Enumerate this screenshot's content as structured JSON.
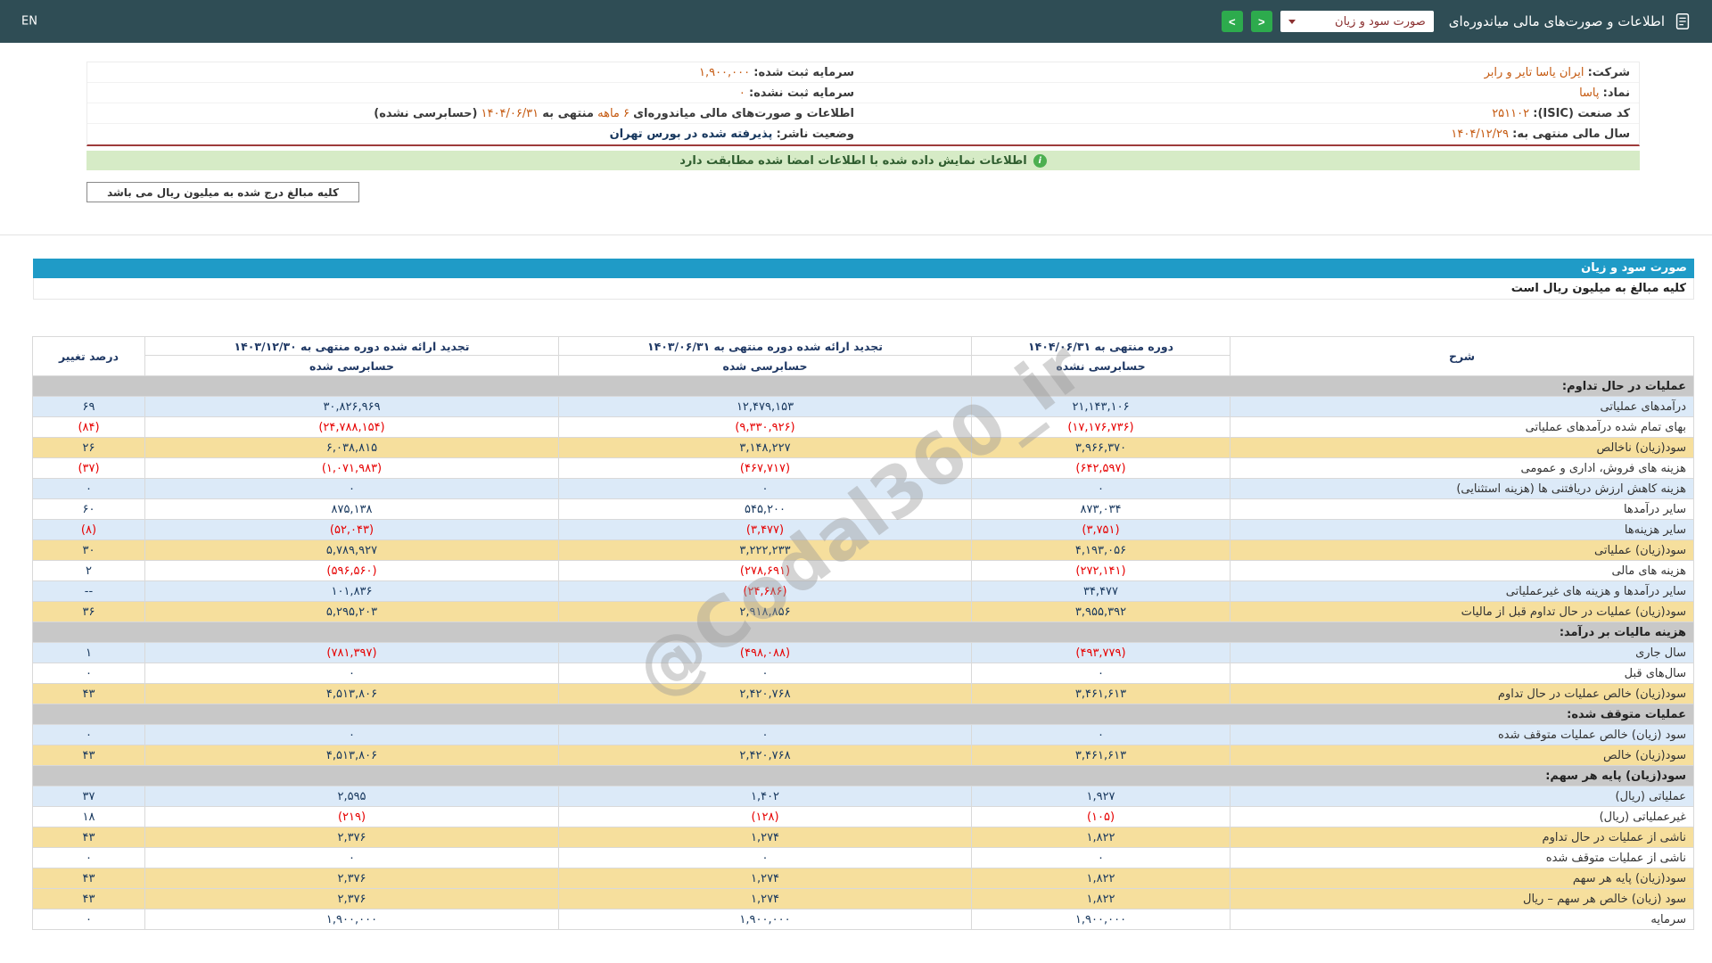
{
  "colors": {
    "topbar": "#2F4D55",
    "accent_blue": "#1F9BC7",
    "row_blue": "#DCEAF8",
    "row_yellow": "#F6DF9D",
    "row_gray": "#C8C8C8",
    "positive_navy": "#17375D",
    "negative_red": "#E60000",
    "value_orange": "#C55A11",
    "banner_green": "#D6EBC6"
  },
  "header": {
    "en_label": "EN",
    "app_title": "اطلاعات و صورت‌های مالی میاندوره‌ای",
    "statement_dropdown_value": "صورت سود و زیان",
    "nav_forward_icon": ">",
    "nav_back_icon": "<"
  },
  "company_info": {
    "company_label": "شرکت:",
    "company_value": "ایران یاسا تایر و رابر",
    "symbol_label": "نماد:",
    "symbol_value": "پاسا",
    "isic_label": "کد صنعت (ISIC):",
    "isic_value": "۲۵۱۱۰۲",
    "fiscal_year_label": "سال مالی منتهی به:",
    "fiscal_year_value": "۱۴۰۴/۱۲/۲۹",
    "registered_capital_label": "سرمایه ثبت شده:",
    "registered_capital_value": "۱,۹۰۰,۰۰۰",
    "unregistered_capital_label": "سرمایه ثبت نشده:",
    "unregistered_capital_value": "۰",
    "period_label": "اطلاعات و صورت‌های مالی میاندوره‌ای",
    "period_duration": "۶ ماهه",
    "period_mid": "منتهی به",
    "period_date": "۱۴۰۴/۰۶/۳۱",
    "period_suffix": "(حسابرسی نشده)",
    "publisher_status_label": "وضعیت ناشر:",
    "publisher_status_value": "پذیرفته شده در بورس تهران"
  },
  "banner": {
    "text": "اطلاعات نمایش داده شده با اطلاعات امضا شده مطابقت دارد",
    "icon": "i"
  },
  "note": "کلیه مبالغ درج شده به میلیون ریال می باشد",
  "statement": {
    "title": "صورت سود و زیان",
    "subtitle": "کلیه مبالغ به میلیون ریال است",
    "watermark": "@Codal360_ir",
    "columns": {
      "description": "شرح",
      "current_period": "دوره منتهی به ۱۴۰۴/۰۶/۳۱",
      "current_sub": "حسابرسی نشده",
      "prior_period": "تجدید ارائه شده دوره منتهی به ۱۴۰۳/۰۶/۳۱",
      "prior_sub": "حسابرسی شده",
      "annual_period": "تجدید ارائه شده دوره منتهی به ۱۴۰۳/۱۲/۳۰",
      "annual_sub": "حسابرسی شده",
      "change": "درصد تغییر"
    },
    "rows": [
      {
        "type": "section",
        "label": "عملیات در حال تداوم:"
      },
      {
        "type": "data",
        "shade": "blue",
        "label": "درآمدهای عملیاتی",
        "current": "۲۱,۱۴۳,۱۰۶",
        "prior": "۱۲,۴۷۹,۱۵۳",
        "annual": "۳۰,۸۲۶,۹۶۹",
        "change": "۶۹"
      },
      {
        "type": "data",
        "shade": "white",
        "label": "بهای تمام شده درآمدهای عملیاتی",
        "current": "(۱۷,۱۷۶,۷۳۶)",
        "prior": "(۹,۳۳۰,۹۲۶)",
        "annual": "(۲۴,۷۸۸,۱۵۴)",
        "change": "(۸۴)"
      },
      {
        "type": "data",
        "shade": "yellow",
        "label": "سود(زیان) ناخالص",
        "current": "۳,۹۶۶,۳۷۰",
        "prior": "۳,۱۴۸,۲۲۷",
        "annual": "۶,۰۳۸,۸۱۵",
        "change": "۲۶"
      },
      {
        "type": "data",
        "shade": "white",
        "label": "هزینه های فروش، اداری و عمومی",
        "current": "(۶۴۲,۵۹۷)",
        "prior": "(۴۶۷,۷۱۷)",
        "annual": "(۱,۰۷۱,۹۸۳)",
        "change": "(۳۷)"
      },
      {
        "type": "data",
        "shade": "blue",
        "label": "هزینه کاهش ارزش دریافتنی ها (هزینه استثنایی)",
        "current": "۰",
        "prior": "۰",
        "annual": "۰",
        "change": "۰"
      },
      {
        "type": "data",
        "shade": "white",
        "label": "سایر درآمدها",
        "current": "۸۷۳,۰۳۴",
        "prior": "۵۴۵,۲۰۰",
        "annual": "۸۷۵,۱۳۸",
        "change": "۶۰"
      },
      {
        "type": "data",
        "shade": "blue",
        "label": "سایر هزینه‌ها",
        "current": "(۳,۷۵۱)",
        "prior": "(۳,۴۷۷)",
        "annual": "(۵۲,۰۴۳)",
        "change": "(۸)"
      },
      {
        "type": "data",
        "shade": "yellow",
        "label": "سود(زیان) عملیاتی",
        "current": "۴,۱۹۳,۰۵۶",
        "prior": "۳,۲۲۲,۲۳۳",
        "annual": "۵,۷۸۹,۹۲۷",
        "change": "۳۰"
      },
      {
        "type": "data",
        "shade": "white",
        "label": "هزینه های مالی",
        "current": "(۲۷۲,۱۴۱)",
        "prior": "(۲۷۸,۶۹۱)",
        "annual": "(۵۹۶,۵۶۰)",
        "change": "۲"
      },
      {
        "type": "data",
        "shade": "blue",
        "label": "سایر درآمدها و هزینه های غیرعملیاتی",
        "current": "۳۴,۴۷۷",
        "prior": "(۲۴,۶۸۶)",
        "annual": "۱۰۱,۸۳۶",
        "change": "--"
      },
      {
        "type": "data",
        "shade": "yellow",
        "label": "سود(زیان) عملیات در حال تداوم قبل از مالیات",
        "current": "۳,۹۵۵,۳۹۲",
        "prior": "۲,۹۱۸,۸۵۶",
        "annual": "۵,۲۹۵,۲۰۳",
        "change": "۳۶"
      },
      {
        "type": "section",
        "label": "هزینه مالیات بر درآمد:"
      },
      {
        "type": "data",
        "shade": "blue",
        "label": "سال جاری",
        "current": "(۴۹۳,۷۷۹)",
        "prior": "(۴۹۸,۰۸۸)",
        "annual": "(۷۸۱,۳۹۷)",
        "change": "۱"
      },
      {
        "type": "data",
        "shade": "white",
        "label": "سال‌های قبل",
        "current": "۰",
        "prior": "۰",
        "annual": "۰",
        "change": "۰"
      },
      {
        "type": "data",
        "shade": "yellow",
        "label": "سود(زیان) خالص عملیات در حال تداوم",
        "current": "۳,۴۶۱,۶۱۳",
        "prior": "۲,۴۲۰,۷۶۸",
        "annual": "۴,۵۱۳,۸۰۶",
        "change": "۴۳"
      },
      {
        "type": "section",
        "label": "عملیات متوقف شده:"
      },
      {
        "type": "data",
        "shade": "blue",
        "label": "سود (زیان) خالص عملیات متوقف شده",
        "current": "۰",
        "prior": "۰",
        "annual": "۰",
        "change": "۰"
      },
      {
        "type": "data",
        "shade": "yellow",
        "label": "سود(زیان) خالص",
        "current": "۳,۴۶۱,۶۱۳",
        "prior": "۲,۴۲۰,۷۶۸",
        "annual": "۴,۵۱۳,۸۰۶",
        "change": "۴۳"
      },
      {
        "type": "section",
        "label": "سود(زیان) پایه هر سهم:"
      },
      {
        "type": "data",
        "shade": "blue",
        "label": "عملیاتی (ریال)",
        "current": "۱,۹۲۷",
        "prior": "۱,۴۰۲",
        "annual": "۲,۵۹۵",
        "change": "۳۷"
      },
      {
        "type": "data",
        "shade": "white",
        "label": "غیرعملیاتی (ریال)",
        "current": "(۱۰۵)",
        "prior": "(۱۲۸)",
        "annual": "(۲۱۹)",
        "change": "۱۸"
      },
      {
        "type": "data",
        "shade": "yellow",
        "label": "ناشی از عملیات در حال تداوم",
        "current": "۱,۸۲۲",
        "prior": "۱,۲۷۴",
        "annual": "۲,۳۷۶",
        "change": "۴۳"
      },
      {
        "type": "data",
        "shade": "white",
        "label": "ناشی از عملیات متوقف شده",
        "current": "۰",
        "prior": "۰",
        "annual": "۰",
        "change": "۰"
      },
      {
        "type": "data",
        "shade": "yellow",
        "label": "سود(زیان) پایه هر سهم",
        "current": "۱,۸۲۲",
        "prior": "۱,۲۷۴",
        "annual": "۲,۳۷۶",
        "change": "۴۳"
      },
      {
        "type": "data",
        "shade": "yellow",
        "label": "سود (زیان) خالص هر سهم – ریال",
        "current": "۱,۸۲۲",
        "prior": "۱,۲۷۴",
        "annual": "۲,۳۷۶",
        "change": "۴۳"
      },
      {
        "type": "data",
        "shade": "white",
        "label": "سرمایه",
        "current": "۱,۹۰۰,۰۰۰",
        "prior": "۱,۹۰۰,۰۰۰",
        "annual": "۱,۹۰۰,۰۰۰",
        "change": "۰"
      }
    ]
  }
}
